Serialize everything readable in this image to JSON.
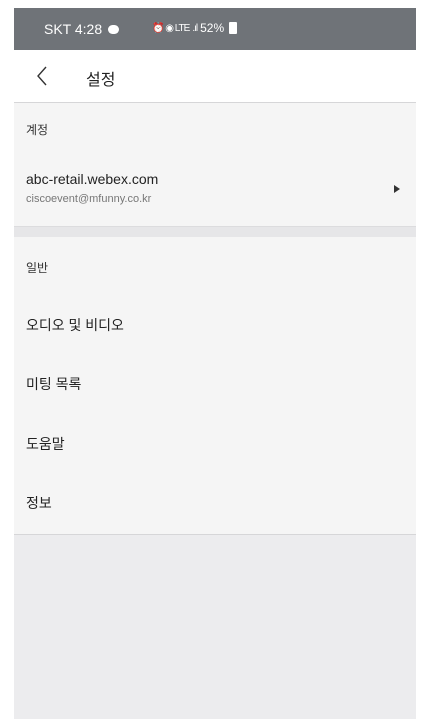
{
  "status_bar": {
    "carrier_time": "SKT 4:28",
    "indicators": "⏰ ◉ LTE",
    "signal": ".ıl",
    "battery": "52%",
    "icons": [
      "chat-icon",
      "alarm-icon",
      "signal-icon",
      "battery-icon"
    ]
  },
  "header": {
    "title": "설정",
    "back_icon": "chevron-left-icon"
  },
  "account_section": {
    "label": "계정",
    "host": "abc-retail.webex.com",
    "email": "ciscoevent@mfunny.co.kr",
    "arrow_icon": "triangle-right-icon"
  },
  "general_section": {
    "label": "일반",
    "items": [
      {
        "label": "오디오 및 비디오"
      },
      {
        "label": "미팅 목록"
      },
      {
        "label": "도움말"
      },
      {
        "label": "정보"
      }
    ]
  },
  "colors": {
    "status_bar_bg": "#6f7378",
    "section_bg": "#f5f5f5",
    "empty_bg": "#ececee"
  }
}
